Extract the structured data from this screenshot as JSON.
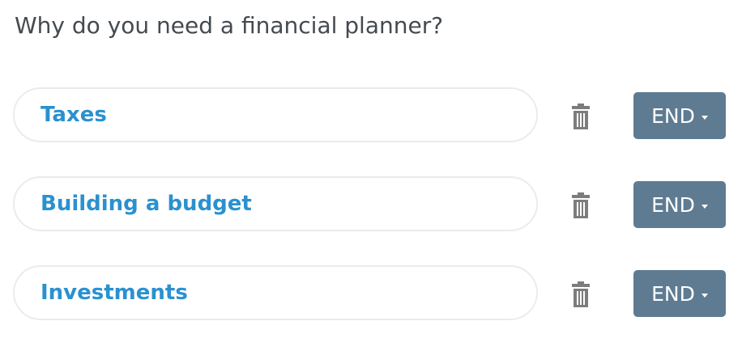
{
  "question": "Why do you need a financial planner?",
  "answers": [
    {
      "label": "Taxes",
      "action": "END"
    },
    {
      "label": "Building a budget",
      "action": "END"
    },
    {
      "label": "Investments",
      "action": "END"
    }
  ],
  "icons": {
    "delete": "trash-icon",
    "dropdown": "caret-down-icon"
  },
  "colors": {
    "question_text": "#444a50",
    "answer_text": "#2a91cf",
    "answer_border": "#e9ecee",
    "trash": "#7c7c7c",
    "end_button_bg": "#5e7b92",
    "end_button_text": "#ffffff"
  }
}
